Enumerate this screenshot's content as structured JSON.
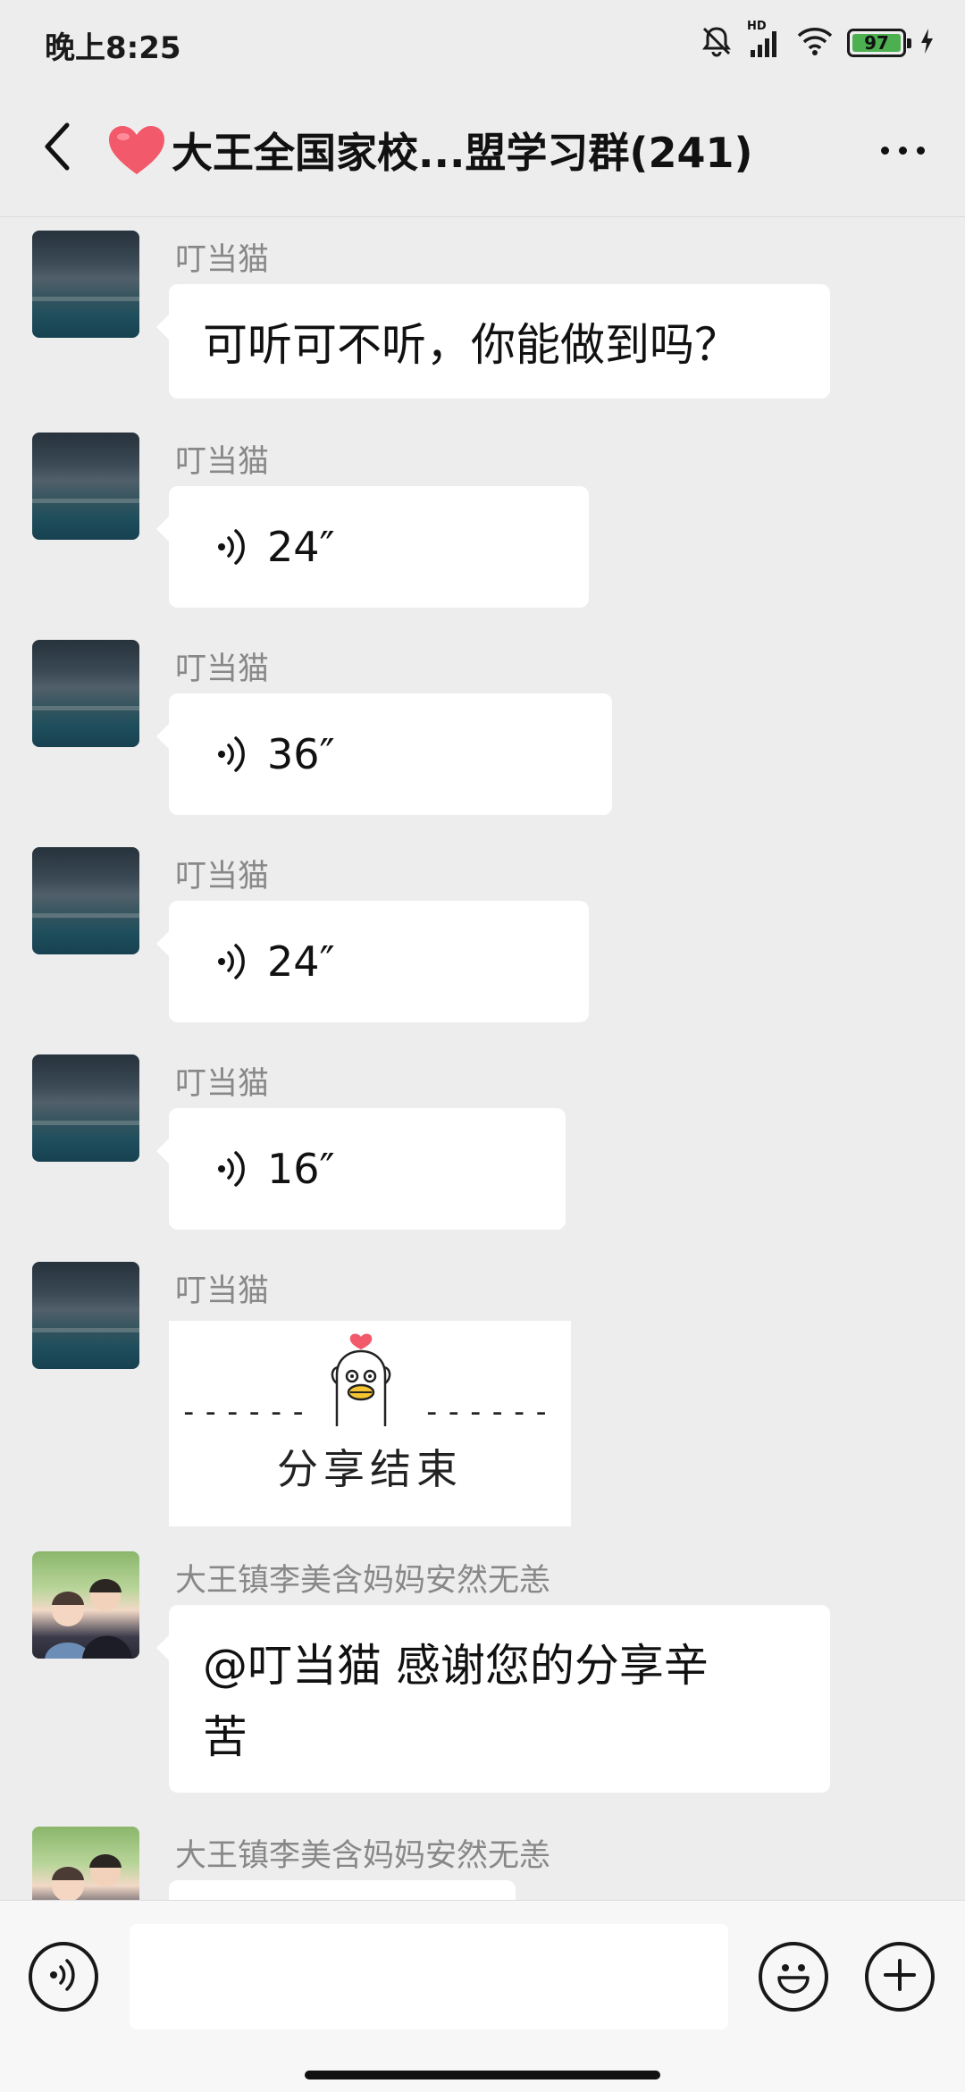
{
  "status_bar": {
    "time": "晚上8:25",
    "hd_label": "HD",
    "battery": "97",
    "icons": [
      "mute-bell-icon",
      "signal-icon",
      "wifi-icon",
      "battery-icon",
      "charging-icon"
    ]
  },
  "header": {
    "title": "大王全国家校...盟学习群(241)",
    "icons": [
      "back-arrow-icon",
      "heart-icon",
      "more-icon"
    ]
  },
  "messages": [
    {
      "sender": "叮当猫",
      "type": "text",
      "content": "可听可不听，你能做到吗？"
    },
    {
      "sender": "叮当猫",
      "type": "voice",
      "duration": "24″"
    },
    {
      "sender": "叮当猫",
      "type": "voice",
      "duration": "36″"
    },
    {
      "sender": "叮当猫",
      "type": "voice",
      "duration": "24″"
    },
    {
      "sender": "叮当猫",
      "type": "voice",
      "duration": "16″"
    },
    {
      "sender": "叮当猫",
      "type": "sticker",
      "dashes_left": "------",
      "dashes_right": "------",
      "content": "分享结束"
    },
    {
      "sender": "大王镇李美含妈妈安然无恙",
      "type": "text",
      "content_line1": "@叮当猫  感谢您的分享辛",
      "content_line2": "苦"
    },
    {
      "sender": "大王镇李美含妈妈安然无恙",
      "type": "text",
      "content": ""
    }
  ],
  "bottom_bar": {
    "input_value": "",
    "icons": [
      "voice-input-icon",
      "emoji-icon",
      "plus-icon"
    ]
  },
  "colors": {
    "background": "#ededed",
    "bubble": "#ffffff",
    "battery_fill": "#4caf50",
    "heart": "#f25a6b"
  }
}
